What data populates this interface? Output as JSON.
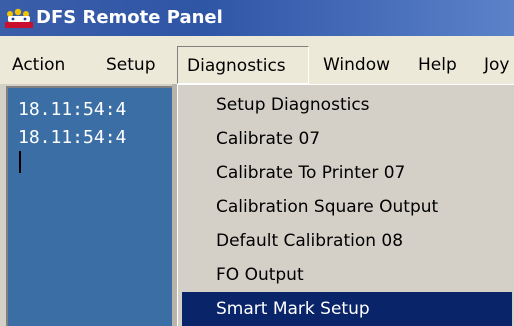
{
  "window": {
    "title": "DFS Remote Panel",
    "app_icon": "elephant-app-icon"
  },
  "menubar": {
    "items": [
      {
        "label": "Action"
      },
      {
        "label": "Setup"
      },
      {
        "label": "Diagnostics",
        "active": true
      },
      {
        "label": "Window"
      },
      {
        "label": "Help"
      },
      {
        "label": "Joy"
      }
    ]
  },
  "log": {
    "lines": [
      "18.11:54:4",
      "18.11:54:4"
    ]
  },
  "diagnostics_menu": {
    "items": [
      {
        "label": "Setup Diagnostics"
      },
      {
        "label": "Calibrate 07"
      },
      {
        "label": "Calibrate To Printer 07"
      },
      {
        "label": "Calibration Square Output"
      },
      {
        "label": "Default Calibration 08"
      },
      {
        "label": "FO Output"
      },
      {
        "label": "Smart Mark Setup",
        "highlighted": true
      }
    ]
  },
  "colors": {
    "titlebar": "#2f55a6",
    "content_bg": "#3a6ea5",
    "highlight": "#0a246a",
    "menu_bg": "#d4d0c8"
  }
}
